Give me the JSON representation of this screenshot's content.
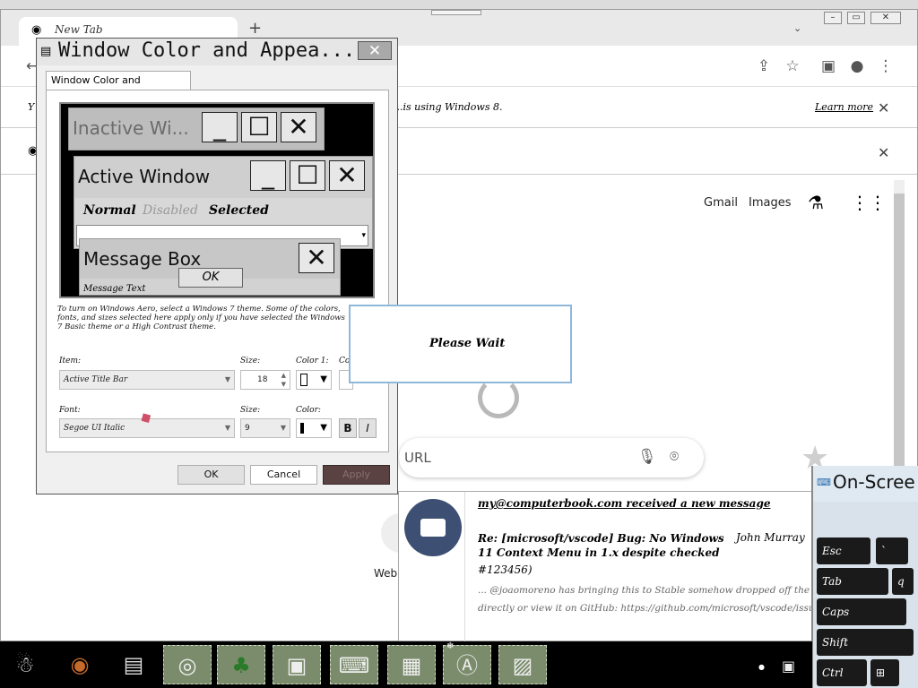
{
  "browser": {
    "tab_title": "New Tab",
    "new_tab_symbol": "+",
    "infobar1_text_left": "Y",
    "infobar1_text_right": "...is using Windows 8.",
    "infobar1_link": "Learn more",
    "top_links": [
      "Gmail",
      "Images"
    ],
    "search_placeholder": "URL",
    "shortcut_label": "Web"
  },
  "dialog": {
    "title": "Window Color and Appea...",
    "close_symbol": "✕",
    "tab_label": "Window Color and Appearance",
    "preview": {
      "inactive_title": "Inactive Wi...",
      "active_title": "Active Window",
      "menu_items": [
        "Normal",
        "Disabled",
        "Selected"
      ],
      "message_box_title": "Message Box",
      "message_text": "Message Text",
      "ok_label": "OK"
    },
    "description": "To turn on Windows Aero, select a Windows 7 theme. Some of the colors, fonts, and sizes selected here apply only if you have selected the Windows 7 Basic theme or a High Contrast theme.",
    "item_label": "Item:",
    "item_value": "Active Title Bar",
    "size_label": "Size:",
    "size_value": "18",
    "color1_label": "Color 1:",
    "color2_label": "Co",
    "font_label": "Font:",
    "font_value": "Segoe UI Italic",
    "font_size_label": "Size:",
    "font_size_value": "9",
    "font_color_label": "Color:",
    "bold_label": "B",
    "italic_label": "I",
    "ok": "OK",
    "cancel": "Cancel",
    "apply": "Apply"
  },
  "please_wait": "Please Wait",
  "notification": {
    "header": "my@computerbook.com received a new message",
    "subject": "Re: [microsoft/vscode] Bug: No Windows 11 Context Menu in 1.x despite checked checkbox (Issue",
    "sender": "John Murray",
    "subject_tail": "#123456)",
    "body1": "... @joaomoreno has bringing this to Stable somehow dropped off the radar? -- Reply to this email",
    "body2": "directly or view it on GitHub: https://github.com/microsoft/vscode/issues/... You are receiving this because you are su"
  },
  "osk": {
    "title": "On-Scree",
    "keys": [
      "Esc",
      "`",
      "Tab",
      "q",
      "Caps",
      "Shift",
      "Ctrl"
    ]
  }
}
